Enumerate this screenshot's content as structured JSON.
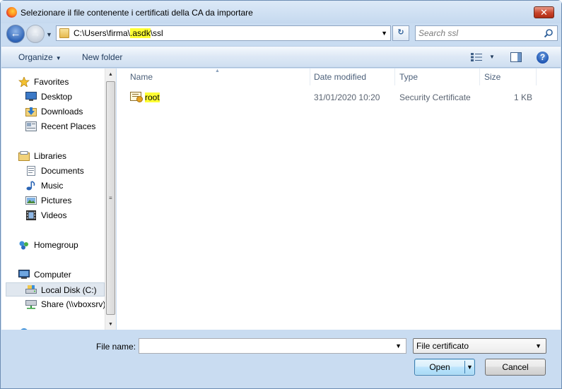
{
  "window": {
    "title": "Selezionare il file contenente i certificati della CA da importare",
    "close_glyph": "✕"
  },
  "address": {
    "path_prefix": "C:\\Users\\firma\\",
    "path_highlight": ".asdk",
    "path_suffix": "\\ssl"
  },
  "search": {
    "placeholder": "Search ssl"
  },
  "toolbar": {
    "organize_label": "Organize",
    "new_folder_label": "New folder"
  },
  "sidebar": {
    "items": [
      {
        "label": "Favorites",
        "icon": "star-icon"
      },
      {
        "label": "Desktop",
        "icon": "desktop-icon"
      },
      {
        "label": "Downloads",
        "icon": "downloads-icon"
      },
      {
        "label": "Recent Places",
        "icon": "recent-places-icon"
      },
      {
        "label": "Libraries",
        "icon": "libraries-icon"
      },
      {
        "label": "Documents",
        "icon": "documents-icon"
      },
      {
        "label": "Music",
        "icon": "music-icon"
      },
      {
        "label": "Pictures",
        "icon": "pictures-icon"
      },
      {
        "label": "Videos",
        "icon": "videos-icon"
      },
      {
        "label": "Homegroup",
        "icon": "homegroup-icon"
      },
      {
        "label": "Computer",
        "icon": "computer-icon"
      },
      {
        "label": "Local Disk (C:)",
        "icon": "local-disk-icon",
        "selected": true
      },
      {
        "label": "Share (\\\\vboxsrv)",
        "icon": "network-share-icon"
      }
    ]
  },
  "filelist": {
    "columns": [
      "Name",
      "Date modified",
      "Type",
      "Size"
    ],
    "rows": [
      {
        "name": "root",
        "date_modified": "31/01/2020 10:20",
        "type": "Security Certificate",
        "size": "1 KB",
        "icon": "certificate-icon"
      }
    ]
  },
  "footer": {
    "filename_label": "File name:",
    "filename_value": "",
    "filetype_value": "File certificato",
    "open_label": "Open",
    "cancel_label": "Cancel"
  },
  "colors": {
    "frame": "#c9dcf1",
    "highlight": "#ffff33",
    "accent": "#1f56b3"
  }
}
